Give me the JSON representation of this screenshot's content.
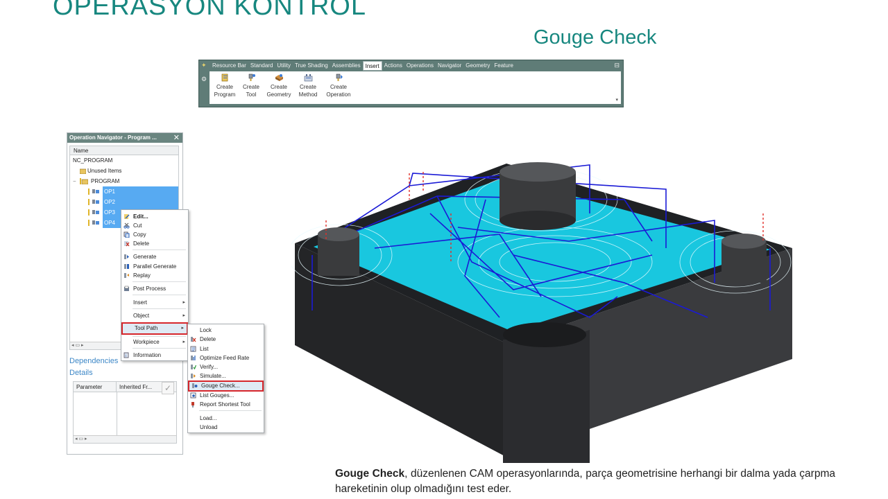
{
  "slide": {
    "title": "OPERASYON KONTROL",
    "subtitle": "Gouge Check"
  },
  "ribbon": {
    "tabs": [
      "Resource Bar",
      "Standard",
      "Utility",
      "True Shading",
      "Assemblies",
      "Insert",
      "Actions",
      "Operations",
      "Navigator",
      "Geometry",
      "Feature"
    ],
    "active_tab": "Insert",
    "buttons": [
      {
        "line1": "Create",
        "line2": "Program",
        "icon": "create-program-icon"
      },
      {
        "line1": "Create",
        "line2": "Tool",
        "icon": "create-tool-icon"
      },
      {
        "line1": "Create",
        "line2": "Geometry",
        "icon": "create-geometry-icon"
      },
      {
        "line1": "Create",
        "line2": "Method",
        "icon": "create-method-icon"
      },
      {
        "line1": "Create",
        "line2": "Operation",
        "icon": "create-operation-icon"
      }
    ]
  },
  "navigator": {
    "title": "Operation Navigator - Program ...",
    "column_header": "Name",
    "root": "NC_PROGRAM",
    "unused": "Unused Items",
    "program": "PROGRAM",
    "operations": [
      "OP1",
      "OP2",
      "OP3",
      "OP4"
    ],
    "dependencies_label": "Dependencies",
    "details_label": "Details",
    "details_columns": [
      "Parameter",
      "Inherited Fr..."
    ]
  },
  "context_menu": {
    "items": [
      {
        "label": "Edit...",
        "bold": true
      },
      {
        "label": "Cut"
      },
      {
        "label": "Copy"
      },
      {
        "label": "Delete"
      },
      {
        "label": "Generate"
      },
      {
        "label": "Parallel Generate"
      },
      {
        "label": "Replay"
      },
      {
        "label": "Post Process"
      },
      {
        "label": "Insert",
        "submenu": true
      },
      {
        "label": "Object",
        "submenu": true
      },
      {
        "label": "Tool Path",
        "submenu": true,
        "highlighted": true
      },
      {
        "label": "Workpiece",
        "submenu": true
      },
      {
        "label": "Information"
      }
    ]
  },
  "submenu": {
    "items": [
      {
        "label": "Lock"
      },
      {
        "label": "Delete"
      },
      {
        "label": "List"
      },
      {
        "label": "Optimize Feed Rate"
      },
      {
        "label": "Verify..."
      },
      {
        "label": "Simulate..."
      },
      {
        "label": "Gouge Check...",
        "highlighted": true
      },
      {
        "label": "List Gouges..."
      },
      {
        "label": "Report Shortest Tool"
      },
      {
        "label": "Load..."
      },
      {
        "label": "Unload"
      }
    ]
  },
  "caption": {
    "bold": "Gouge Check",
    "text": ", düzenlenen CAM operasyonlarında, parça geometrisine  herhangi bir dalma yada çarpma hareketinin olup olmadığını test eder."
  },
  "colors": {
    "title": "#17877f",
    "toolbar_bg": "#5f7c77",
    "selection": "#57aaf2",
    "highlight_border": "#d6262b",
    "toolpath_cyan": "#19d6f0",
    "toolpath_blue": "#1a1ad6",
    "part_gray": "#2e2f31"
  }
}
